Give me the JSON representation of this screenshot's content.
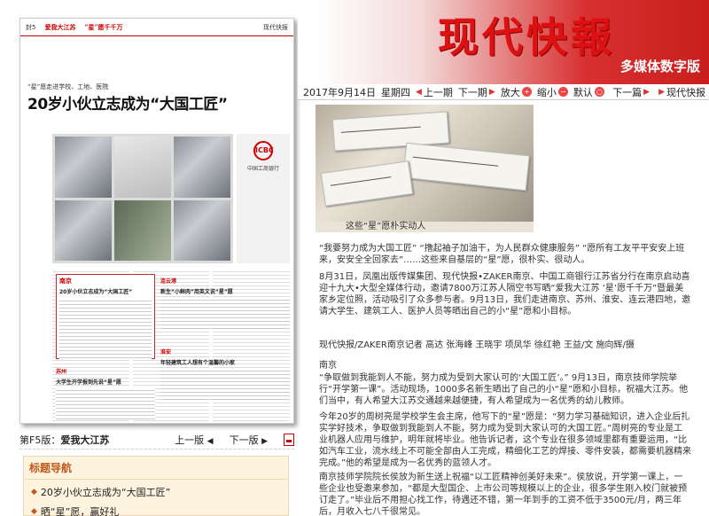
{
  "left": {
    "newspaper": {
      "page_no": "封5",
      "section": "爱我大江苏",
      "section_tag": "“星”愿千千万",
      "paper_name": "现代快报",
      "kicker": "“星”愿走进学校、工地、医院",
      "headline": "20岁小伙立志成为“大国工匠”",
      "ad_logo": "ICBC",
      "ad_text": "中国工商银行",
      "box_tag": "南京",
      "box_title": "20岁小伙立志成为“大国工匠”",
      "side1_tag": "连云港",
      "side1_title": "新生“小鲜肉”用英文说“星”愿",
      "side2_tag": "淮安",
      "side2_title": "年轻建筑工人想有个温馨的小家",
      "side3_tag": "苏州",
      "side3_title": "大学生开学报到先说“星”愿"
    },
    "pagebar": {
      "page_label": "第F5版：",
      "page_name": "爱我大江苏",
      "prev": "上一版",
      "prev_icon": "◀",
      "next": "下一版",
      "next_icon": "▶"
    },
    "toc": {
      "title": "标题导航",
      "items": [
        "20岁小伙立志成为“大国工匠”",
        "晒“星”愿，赢好礼"
      ]
    }
  },
  "banner": {
    "brand": "现代快報",
    "sub": "多媒体数字版"
  },
  "toolbar": {
    "date": "2017年9月14日",
    "weekday": "星期四",
    "prev_issue": "上一期",
    "next_issue": "下一期",
    "zoom_in": "放大",
    "zoom_out": "缩小",
    "default": "默认",
    "next_page": "下一篇",
    "return": "现代快报"
  },
  "article": {
    "caption": "这些“星”愿朴实动人",
    "p1": "“我要努力成为大国工匠” “撸起袖子加油干，为人民群众健康服务” “愿所有工友平平安安上班来，安安全全回家去”……这些来自基层的“星”愿，很朴实、很动人。",
    "p2": "8月31日，凤凰出版传媒集团、现代快报•ZAKER南京、中国工商银行江苏省分行在南京启动喜迎十九大•大型全媒体行动，邀请7800万江苏人隔空书写晒“爱我大江苏 ‘星’愿千千万”暨最美家乡定位照，活动吸引了众多参与者。9月13日，我们走进南京、苏州、淮安、连云港四地，邀请大学生、建筑工人、医护人员等晒出自己的小“星”愿和小目标。",
    "byline": "现代快报/ZAKER南京记者 高达 张海峰 王晓宇 项凤华 徐红艳 王益/文 施向辉/摄",
    "place": "南京",
    "p3": "“争取做到我能到人不能，努力成为受到大家认可的‘大国工匠’。” 9月13日，南京技师学院举行“开学第一课”。活动现场，1000多名新生晒出了自己的小“星”愿和小目标，祝福大江苏。他们当中，有人希望大江苏交通越来越便捷，有人希望成为一名优秀的幼儿教师。",
    "p4": "今年20岁的周树亮是学校学生会主席，他写下的“星”愿是：“努力学习基础知识，进入企业后扎实学好技术，争取做到我能到人不能，努力成为受到大家认可的大国工匠。”周树亮的专业是工业机器人应用与维护，明年就将毕业。他告诉记者，这个专业在很多领域里都有重要运用，“比如汽车工业，流水线上不可能全部由人工完成，精细化工艺的焊接、零件安装，都需要机器精来完成。”他的希望是成为一名优秀的蓝领人才。",
    "p5": "南京技师学院院长侯放为新生送上祝福“以工匠精神创美好未来”。侯放说，开学第一课上，一些企业也受邀来参加，“都是大型国企、上市公司等规模以上的企业，很多学生刚入校门就被预订走了。”毕业后不用担心找工作，待遇还不错，第一年到手的工资不低于3500元/月，两三年后，月收入七八千很常见。"
  }
}
